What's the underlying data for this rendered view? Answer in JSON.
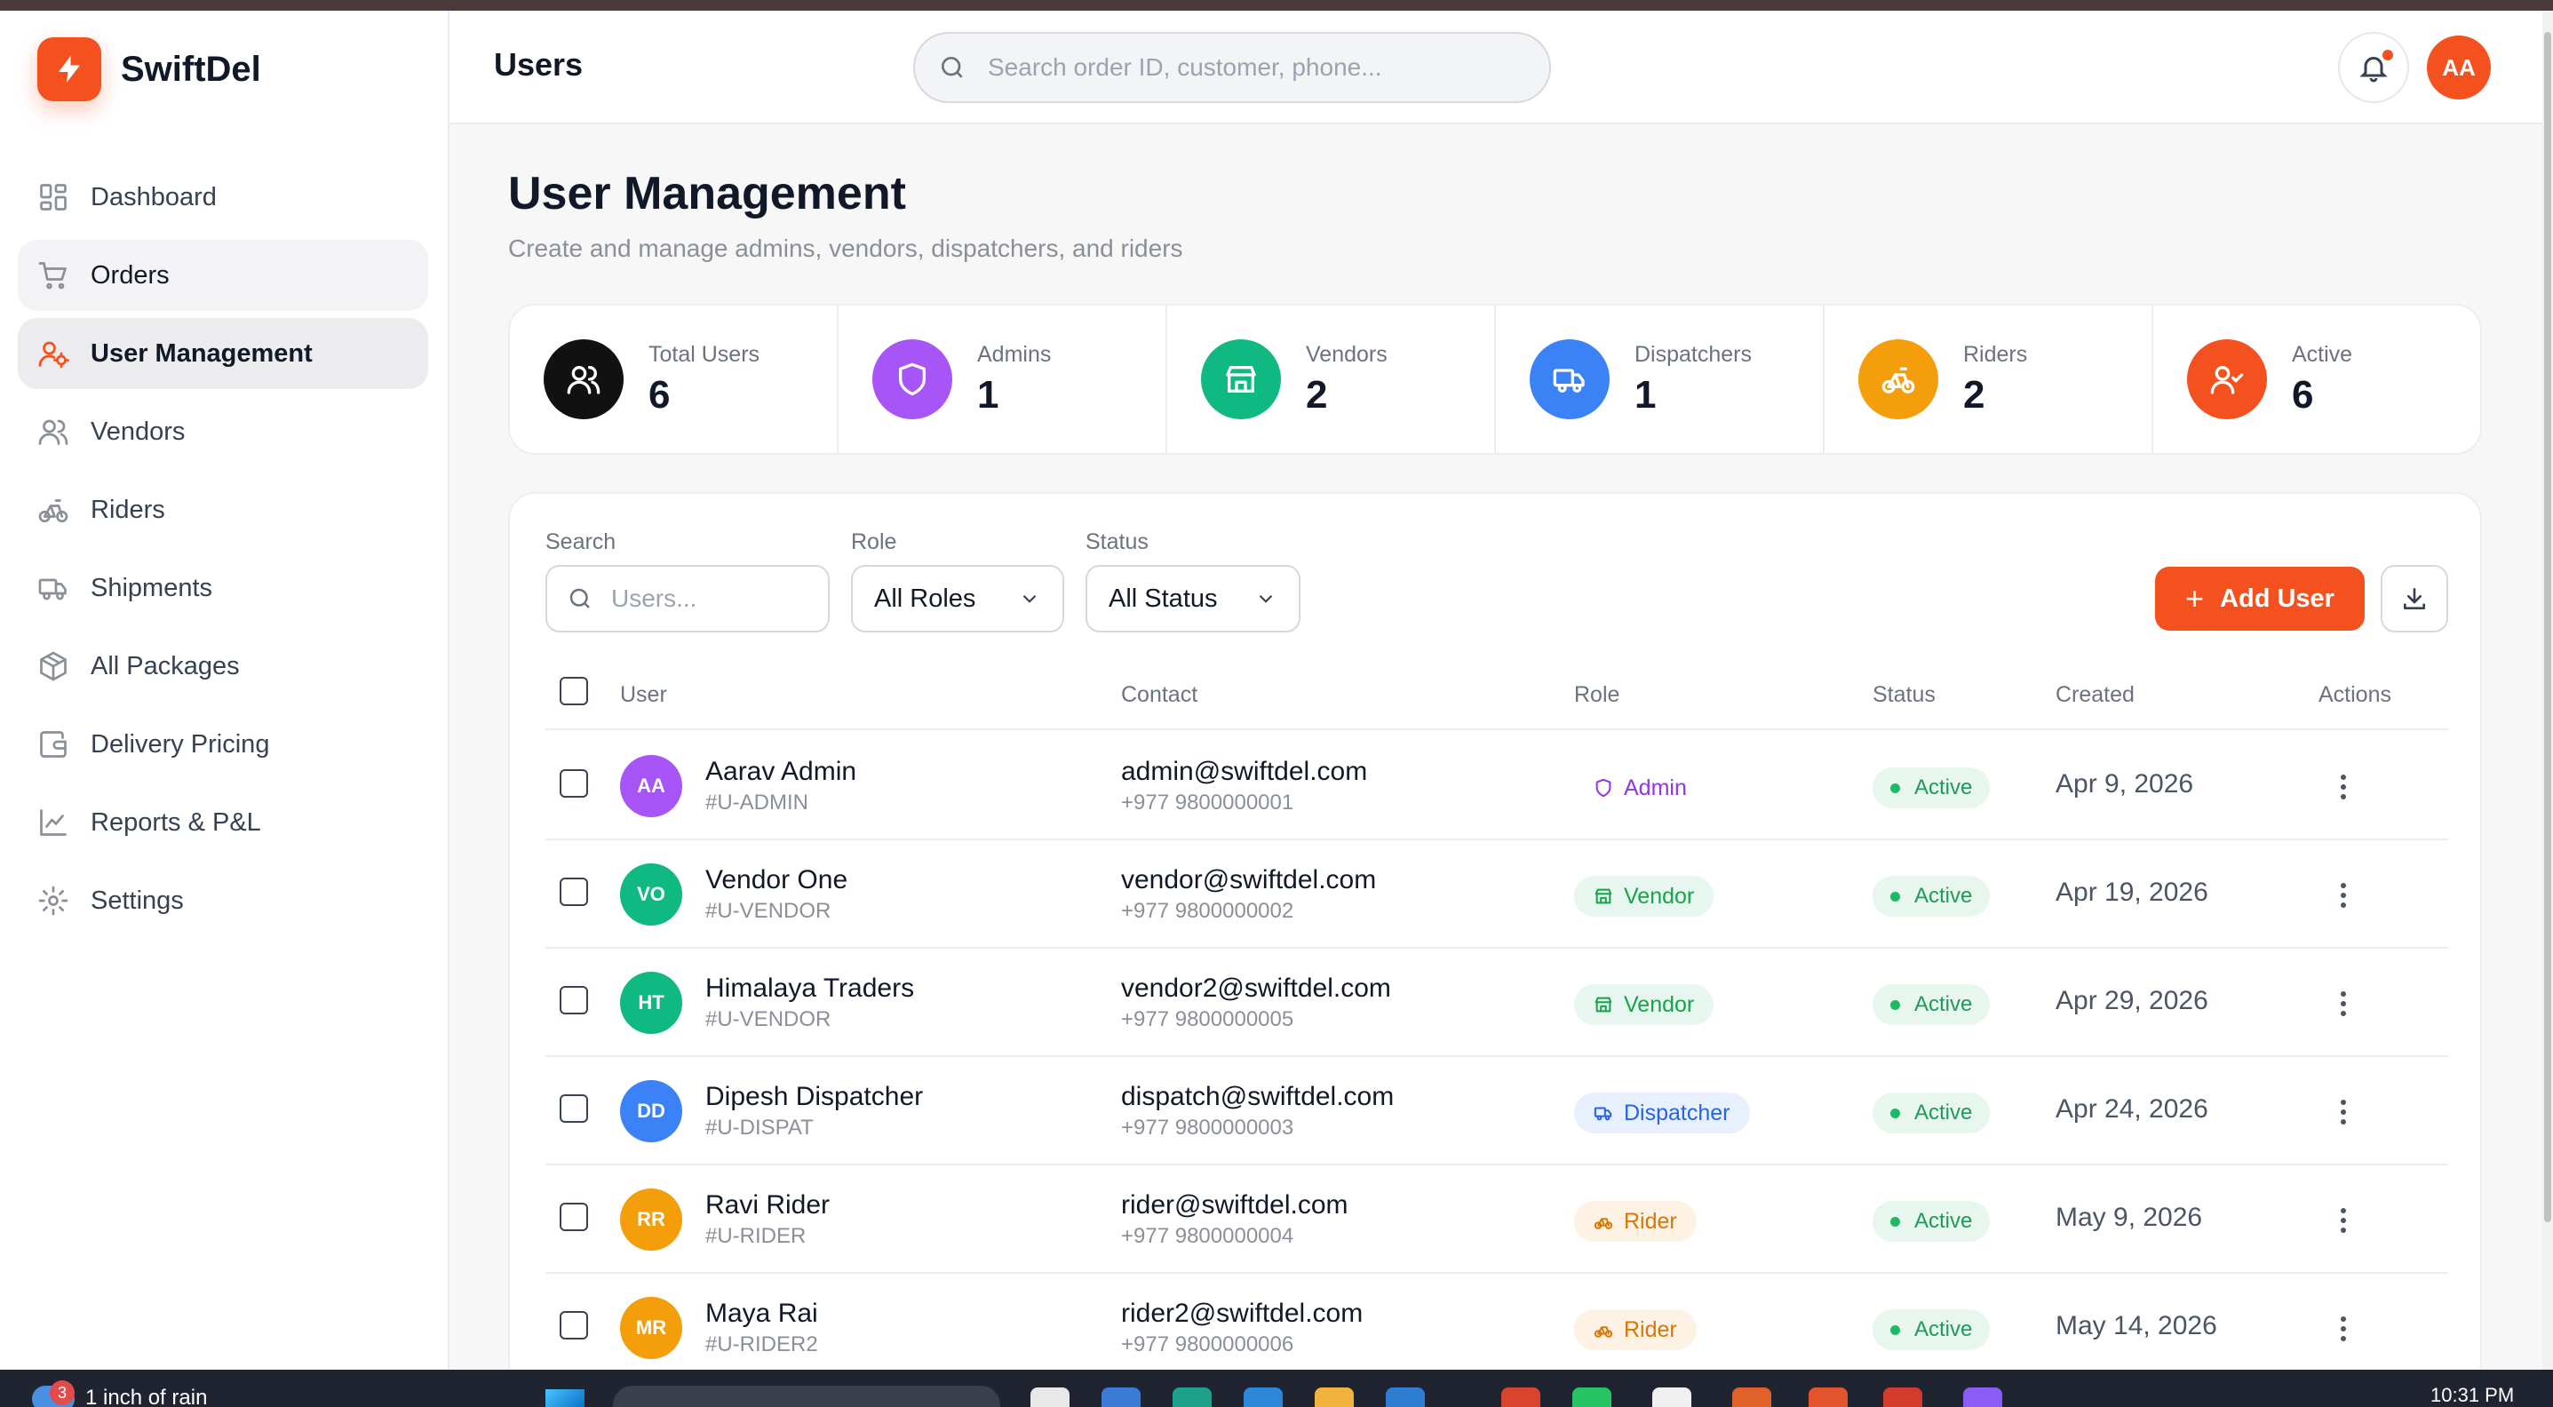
{
  "app": {
    "name": "SwiftDel",
    "accent_color": "#f4511e",
    "logo_icon": "lightning-icon"
  },
  "sidebar": {
    "items": [
      {
        "label": "Dashboard",
        "icon": "dashboard-grid-icon",
        "state": "normal"
      },
      {
        "label": "Orders",
        "icon": "cart-icon",
        "state": "hover"
      },
      {
        "label": "User Management",
        "icon": "user-cog-icon",
        "state": "active"
      },
      {
        "label": "Vendors",
        "icon": "users-icon",
        "state": "normal"
      },
      {
        "label": "Riders",
        "icon": "bicycle-icon",
        "state": "normal"
      },
      {
        "label": "Shipments",
        "icon": "truck-icon",
        "state": "normal"
      },
      {
        "label": "All Packages",
        "icon": "package-icon",
        "state": "normal"
      },
      {
        "label": "Delivery Pricing",
        "icon": "wallet-icon",
        "state": "normal"
      },
      {
        "label": "Reports & P&L",
        "icon": "line-chart-icon",
        "state": "normal"
      },
      {
        "label": "Settings",
        "icon": "gear-icon",
        "state": "normal"
      }
    ]
  },
  "header": {
    "title": "Users",
    "search_placeholder": "Search order ID, customer, phone...",
    "user_initials": "AA"
  },
  "page": {
    "title": "User Management",
    "subtitle": "Create and manage admins, vendors, dispatchers, and riders"
  },
  "stats": [
    {
      "label": "Total Users",
      "value": "6",
      "color": "#111111",
      "icon": "users-icon"
    },
    {
      "label": "Admins",
      "value": "1",
      "color": "#a855f7",
      "icon": "shield-icon"
    },
    {
      "label": "Vendors",
      "value": "2",
      "color": "#10b981",
      "icon": "store-icon"
    },
    {
      "label": "Dispatchers",
      "value": "1",
      "color": "#3b82f6",
      "icon": "truck-icon"
    },
    {
      "label": "Riders",
      "value": "2",
      "color": "#f59e0b",
      "icon": "bicycle-icon"
    },
    {
      "label": "Active",
      "value": "6",
      "color": "#f4511e",
      "icon": "user-check-icon"
    }
  ],
  "filters": {
    "search_label": "Search",
    "search_placeholder": "Users...",
    "role_label": "Role",
    "role_value": "All Roles",
    "status_label": "Status",
    "status_value": "All Status",
    "add_button": "Add User"
  },
  "table": {
    "columns": [
      "User",
      "Contact",
      "Role",
      "Status",
      "Created",
      "Actions"
    ],
    "rows": [
      {
        "initials": "AA",
        "avatar_color": "#a855f7",
        "name": "Aarav Admin",
        "id": "#U-ADMIN",
        "email": "admin@swiftdel.com",
        "phone": "+977 9800000001",
        "role": "Admin",
        "role_icon": "shield-icon",
        "status": "Active",
        "created": "Apr 9, 2026"
      },
      {
        "initials": "VO",
        "avatar_color": "#10b981",
        "name": "Vendor One",
        "id": "#U-VENDOR",
        "email": "vendor@swiftdel.com",
        "phone": "+977 9800000002",
        "role": "Vendor",
        "role_icon": "store-icon",
        "status": "Active",
        "created": "Apr 19, 2026"
      },
      {
        "initials": "HT",
        "avatar_color": "#10b981",
        "name": "Himalaya Traders",
        "id": "#U-VENDOR",
        "email": "vendor2@swiftdel.com",
        "phone": "+977 9800000005",
        "role": "Vendor",
        "role_icon": "store-icon",
        "status": "Active",
        "created": "Apr 29, 2026"
      },
      {
        "initials": "DD",
        "avatar_color": "#3b82f6",
        "name": "Dipesh Dispatcher",
        "id": "#U-DISPAT",
        "email": "dispatch@swiftdel.com",
        "phone": "+977 9800000003",
        "role": "Dispatcher",
        "role_icon": "truck-icon",
        "status": "Active",
        "created": "Apr 24, 2026"
      },
      {
        "initials": "RR",
        "avatar_color": "#f59e0b",
        "name": "Ravi Rider",
        "id": "#U-RIDER",
        "email": "rider@swiftdel.com",
        "phone": "+977 9800000004",
        "role": "Rider",
        "role_icon": "bicycle-icon",
        "status": "Active",
        "created": "May 9, 2026"
      },
      {
        "initials": "MR",
        "avatar_color": "#f59e0b",
        "name": "Maya Rai",
        "id": "#U-RIDER2",
        "email": "rider2@swiftdel.com",
        "phone": "+977 9800000006",
        "role": "Rider",
        "role_icon": "bicycle-icon",
        "status": "Active",
        "created": "May 14, 2026"
      }
    ]
  },
  "role_styles": {
    "Admin": {
      "bg": "#ffffff",
      "fg": "#9333ea"
    },
    "Vendor": {
      "bg": "#e7f7ef",
      "fg": "#16a34a"
    },
    "Dispatcher": {
      "bg": "#e8f0fe",
      "fg": "#2563eb"
    },
    "Rider": {
      "bg": "#fdf2e3",
      "fg": "#d97706"
    }
  },
  "taskbar": {
    "weather_badge": "3",
    "weather_text": "1 inch of rain",
    "time": "10:31 PM"
  }
}
